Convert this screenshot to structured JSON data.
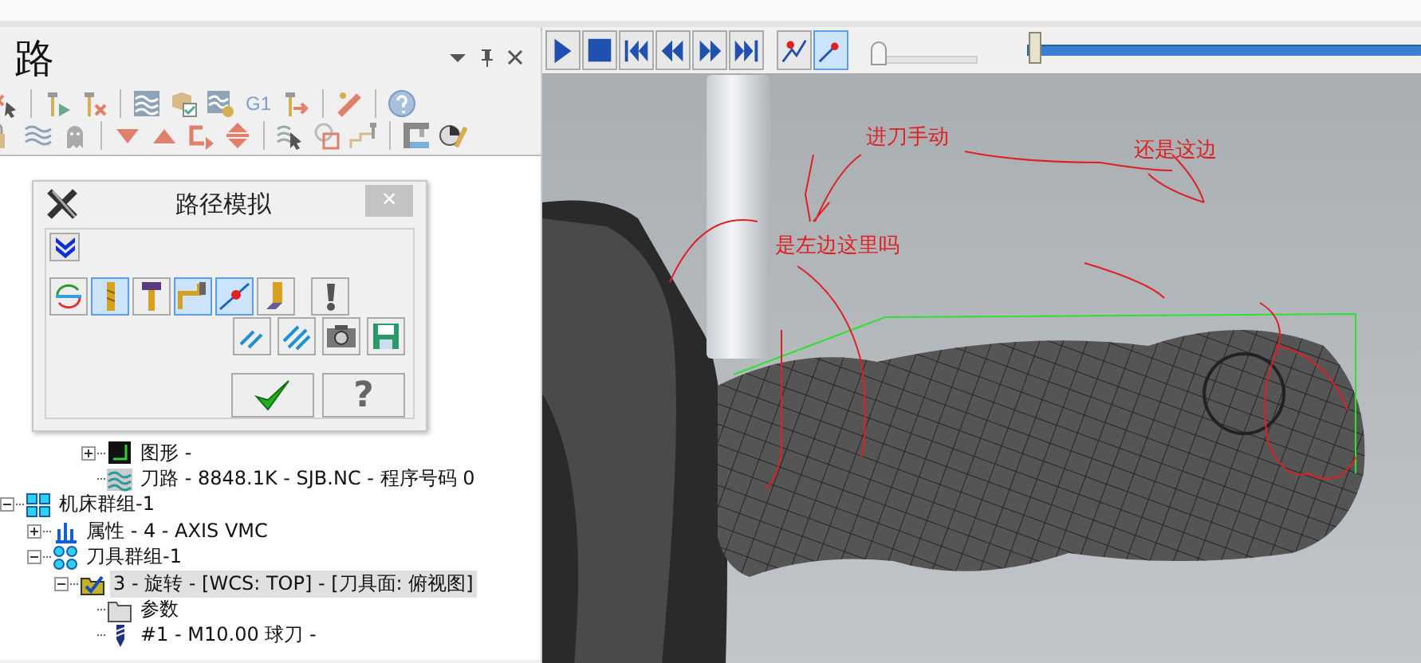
{
  "panel": {
    "title": "路",
    "toolbar_text": "G1"
  },
  "tree": {
    "continued_items": [
      {
        "kind": "graphics",
        "label": "图形 -",
        "expanded": false,
        "selected": false
      },
      {
        "kind": "toolpath",
        "label": "刀路 - 8848.1K - SJB.NC - 程序号码 0",
        "selected": false
      }
    ],
    "items": [
      {
        "kind": "machine-group",
        "label": "机床群组-1",
        "expanded": true,
        "selected": false,
        "children": [
          {
            "kind": "properties",
            "label": "属性 - 4 - AXIS VMC",
            "expanded": false,
            "selected": false
          },
          {
            "kind": "tool-group",
            "label": "刀具群组-1",
            "expanded": true,
            "selected": false,
            "children": [
              {
                "kind": "operation",
                "label": "3 - 旋转 - [WCS: TOP] - [刀具面: 俯视图]",
                "expanded": true,
                "selected": true,
                "children": [
                  {
                    "kind": "folder",
                    "label": "参数",
                    "selected": false
                  },
                  {
                    "kind": "tool",
                    "label": "#1 - M10.00 球刀 -",
                    "selected": false
                  }
                ]
              }
            ]
          }
        ]
      }
    ]
  },
  "dialog": {
    "title": "路径模拟",
    "close": "×",
    "toggles": [
      {
        "kind": "cycle",
        "selected": false
      },
      {
        "kind": "tool",
        "selected": true
      },
      {
        "kind": "holder",
        "selected": false
      },
      {
        "kind": "shank",
        "selected": true
      },
      {
        "kind": "endpoint",
        "selected": true
      },
      {
        "kind": "solid",
        "selected": false
      },
      {
        "kind": "alert",
        "selected": false
      }
    ],
    "actions": [
      {
        "kind": "lines"
      },
      {
        "kind": "lines3"
      },
      {
        "kind": "camera"
      },
      {
        "kind": "save"
      }
    ],
    "help": "?"
  },
  "playback": {
    "modes": [
      {
        "kind": "path",
        "selected": false
      },
      {
        "kind": "point",
        "selected": true
      }
    ],
    "speed": {
      "level": 0.05
    },
    "progress": {
      "level": 0.02
    }
  },
  "viewport": {
    "annotations": [
      {
        "text": "进刀手动"
      },
      {
        "text": "还是这边"
      },
      {
        "text": "是左边这里吗"
      }
    ]
  }
}
